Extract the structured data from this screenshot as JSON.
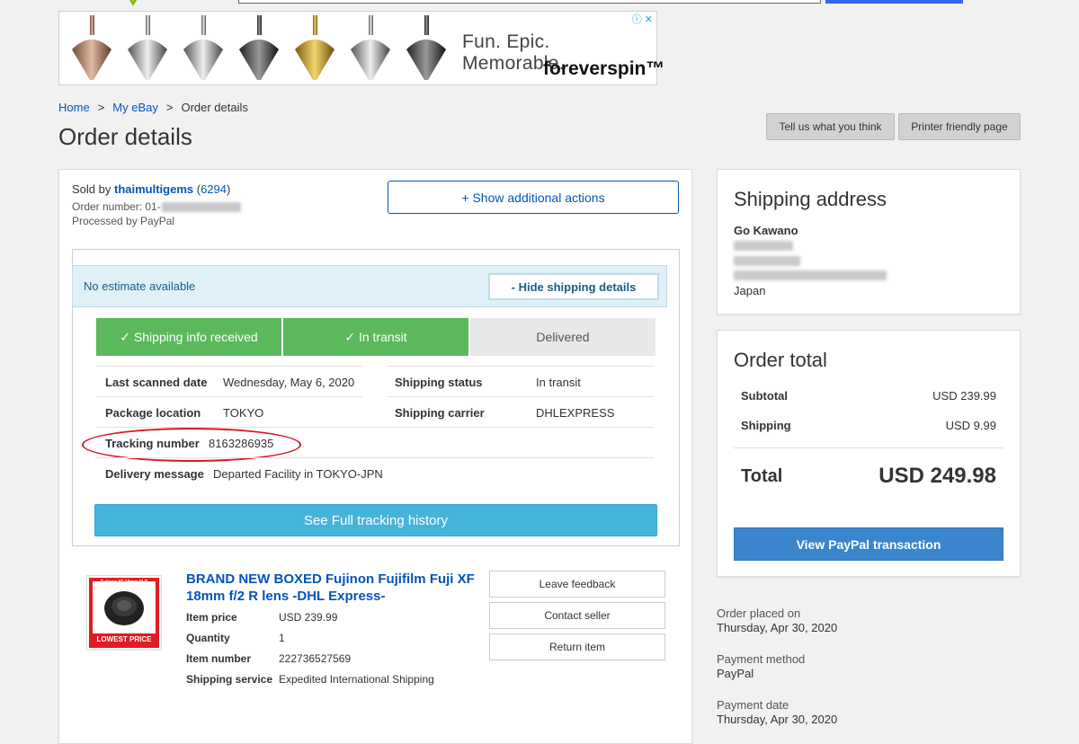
{
  "ad": {
    "slogan": "Fun. Epic. Memorable.",
    "brand": "foreverspin™",
    "icons": [
      "info-icon",
      "close-icon"
    ]
  },
  "breadcrumb": {
    "home": "Home",
    "sep1": ">",
    "my_ebay": "My eBay",
    "sep2": ">",
    "current": "Order details"
  },
  "page_title": "Order details",
  "header_buttons": {
    "feedback": "Tell us what you think",
    "printer": "Printer friendly page"
  },
  "order": {
    "sold_by_label": "Sold by ",
    "seller": "thaimultigems",
    "feedback_open": " (",
    "feedback_score": "6294",
    "feedback_close": ")",
    "order_number_label": "Order number: 01-",
    "processed_by": "Processed by PayPal",
    "show_actions": "+ Show additional actions"
  },
  "shipping": {
    "estimate": "No estimate available",
    "hide_details": "- Hide shipping details",
    "steps": [
      {
        "label": "✓ Shipping info received",
        "state": "done"
      },
      {
        "label": "✓ In transit",
        "state": "done"
      },
      {
        "label": "Delivered",
        "state": "todo"
      }
    ],
    "last_scanned_label": "Last scanned date",
    "last_scanned_value": "Wednesday, May 6, 2020",
    "status_label": "Shipping status",
    "status_value": "In transit",
    "location_label": "Package location",
    "location_value": "TOKYO",
    "carrier_label": "Shipping carrier",
    "carrier_value": "DHLEXPRESS",
    "tracking_label": "Tracking number",
    "tracking_value": "8163286935",
    "delivery_msg_label": "Delivery message",
    "delivery_msg_value": "Departed Facility in TOKYO-JPN",
    "full_history": "See Full tracking history"
  },
  "item": {
    "title": "BRAND NEW BOXED Fujinon Fujifilm Fuji XF 18mm f/2 R lens -DHL Express-",
    "image_caption_top": "Fujinon XF 18mm f2 R",
    "image_caption_bottom": "LOWEST PRICE",
    "price_label": "Item price",
    "price_value": "USD 239.99",
    "quantity_label": "Quantity",
    "quantity_value": "1",
    "number_label": "Item number",
    "number_value": "222736527569",
    "service_label": "Shipping service",
    "service_value": "Expedited International Shipping",
    "actions": [
      "Leave feedback",
      "Contact seller",
      "Return item"
    ]
  },
  "shipping_address": {
    "title": "Shipping address",
    "name": "Go Kawano",
    "country": "Japan"
  },
  "order_total": {
    "title": "Order total",
    "subtotal_label": "Subtotal",
    "subtotal_value": "USD 239.99",
    "shipping_label": "Shipping",
    "shipping_value": "USD 9.99",
    "total_label": "Total",
    "total_value": "USD 249.98",
    "paypal_button": "View PayPal transaction"
  },
  "meta": {
    "placed_label": "Order placed on",
    "placed_value": "Thursday, Apr 30, 2020",
    "method_label": "Payment method",
    "method_value": "PayPal",
    "date_label": "Payment date",
    "date_value": "Thursday, Apr 30, 2020"
  },
  "colors": {
    "link": "#0654ba",
    "done_step": "#5cb85c",
    "tracking_button": "#45b4db",
    "paypal_button": "#3b85cc",
    "annotation_oval": "#d9181f"
  }
}
